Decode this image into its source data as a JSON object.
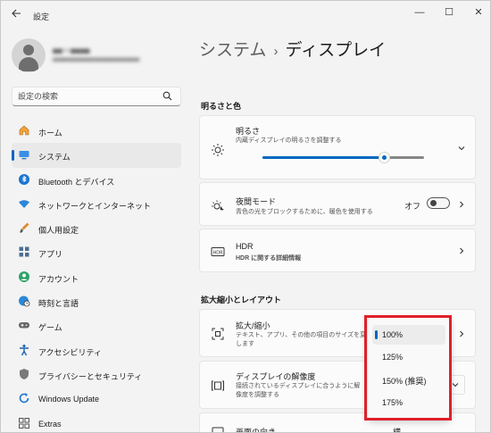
{
  "window": {
    "app_title": "設定",
    "minimize_glyph": "—",
    "maximize_glyph": "☐",
    "close_glyph": "✕"
  },
  "profile": {
    "name": "■■ー■■■■",
    "email": "■■■■■■■■■■■■■■■■■■■■■■■"
  },
  "search": {
    "placeholder": "設定の検索"
  },
  "sidebar": {
    "items": [
      {
        "label": "ホーム",
        "icon": "home-icon",
        "active": false
      },
      {
        "label": "システム",
        "icon": "system-icon",
        "active": true
      },
      {
        "label": "Bluetooth とデバイス",
        "icon": "bluetooth-icon",
        "active": false
      },
      {
        "label": "ネットワークとインターネット",
        "icon": "wifi-icon",
        "active": false
      },
      {
        "label": "個人用設定",
        "icon": "brush-icon",
        "active": false
      },
      {
        "label": "アプリ",
        "icon": "apps-icon",
        "active": false
      },
      {
        "label": "アカウント",
        "icon": "account-icon",
        "active": false
      },
      {
        "label": "時刻と言語",
        "icon": "globe-clock-icon",
        "active": false
      },
      {
        "label": "ゲーム",
        "icon": "gamepad-icon",
        "active": false
      },
      {
        "label": "アクセシビリティ",
        "icon": "accessibility-icon",
        "active": false
      },
      {
        "label": "プライバシーとセキュリティ",
        "icon": "shield-icon",
        "active": false
      },
      {
        "label": "Windows Update",
        "icon": "update-icon",
        "active": false
      },
      {
        "label": "Extras",
        "icon": "extras-icon",
        "active": false
      }
    ]
  },
  "breadcrumb": {
    "parent": "システム",
    "separator": "›",
    "current": "ディスプレイ"
  },
  "sections": {
    "brightness_color": "明るさと色",
    "scale_layout": "拡大縮小とレイアウト"
  },
  "brightness": {
    "title": "明るさ",
    "subtitle": "内蔵ディスプレイの明るさを調整する",
    "level": 0.75
  },
  "night_light": {
    "title": "夜間モード",
    "subtitle": "青色の光をブロックするために、暖色を使用する",
    "state_label": "オフ"
  },
  "hdr": {
    "title": "HDR",
    "link": "HDR に関する詳細情報"
  },
  "scale": {
    "title": "拡大/縮小",
    "subtitle_line1": "テキスト、アプリ、その他の項目のサイズを変更",
    "subtitle_line2": "します"
  },
  "resolution": {
    "title": "ディスプレイの解像度",
    "subtitle_line1": "接続されているディスプレイに合うように解",
    "subtitle_line2": "像度を調整する"
  },
  "orientation": {
    "title": "画面の向き",
    "value": "横"
  },
  "scale_options": [
    "100%",
    "125%",
    "150% (推奨)",
    "175%"
  ],
  "scale_selected_index": 0,
  "colors": {
    "accent": "#0067c0",
    "highlight_box": "#e0202a"
  }
}
